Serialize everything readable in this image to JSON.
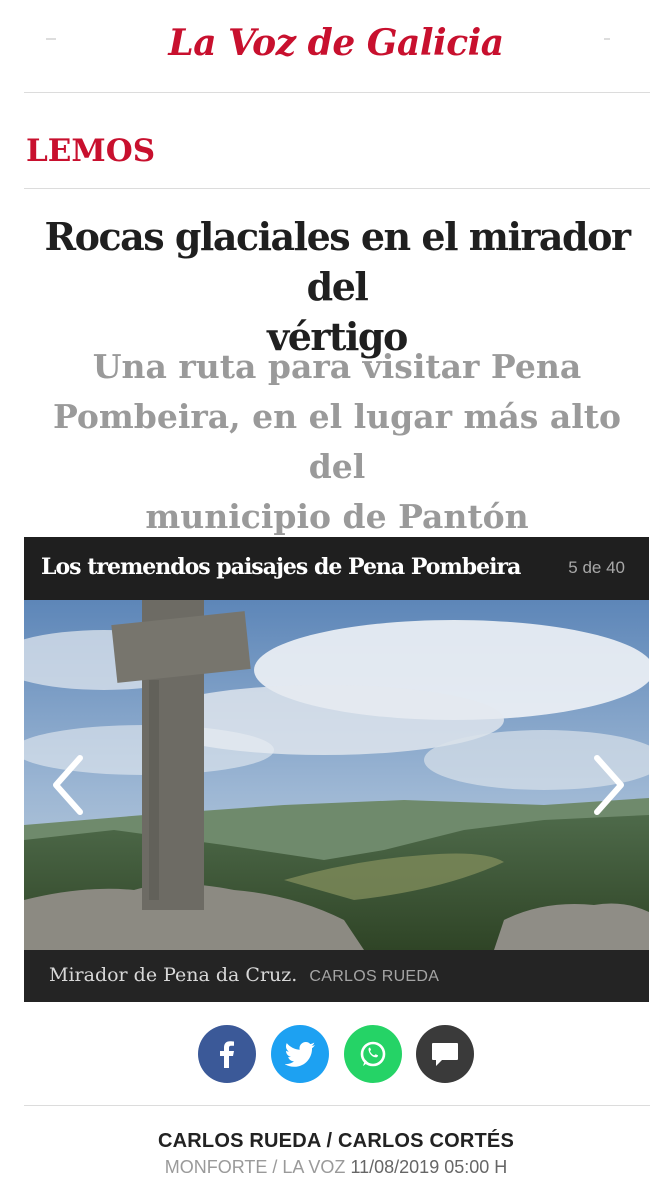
{
  "masthead": {
    "logo_text": "La Voz de Galicia"
  },
  "section": {
    "label": "LEMOS"
  },
  "article": {
    "headline_line1": "Rocas glaciales en el mirador del",
    "headline_line2": "vértigo",
    "subheadline_line1": "Una ruta para visitar Pena",
    "subheadline_line2": "Pombeira, en el lugar más alto del",
    "subheadline_line3": "municipio de Pantón"
  },
  "gallery": {
    "title": "Los tremendos paisajes de Pena Pombeira",
    "counter": "5 de 40",
    "caption": "Mirador de Pena da Cruz.",
    "credit": "CARLOS RUEDA",
    "prev_icon": "chevron-left-icon",
    "next_icon": "chevron-right-icon"
  },
  "share": {
    "buttons": [
      {
        "name": "facebook",
        "icon": "facebook-icon",
        "color": "#3b5998"
      },
      {
        "name": "twitter",
        "icon": "twitter-icon",
        "color": "#1da1f2"
      },
      {
        "name": "whatsapp",
        "icon": "whatsapp-icon",
        "color": "#25d366"
      },
      {
        "name": "comments",
        "icon": "comment-icon",
        "color": "#3a3a3a"
      }
    ]
  },
  "byline": {
    "authors": "CARLOS RUEDA / CARLOS CORTÉS",
    "location": "MONFORTE / LA VOZ",
    "datetime": "11/08/2019 05:00 H"
  },
  "colors": {
    "brand": "#c8102e",
    "gallery_bg": "#1f1f1f"
  }
}
